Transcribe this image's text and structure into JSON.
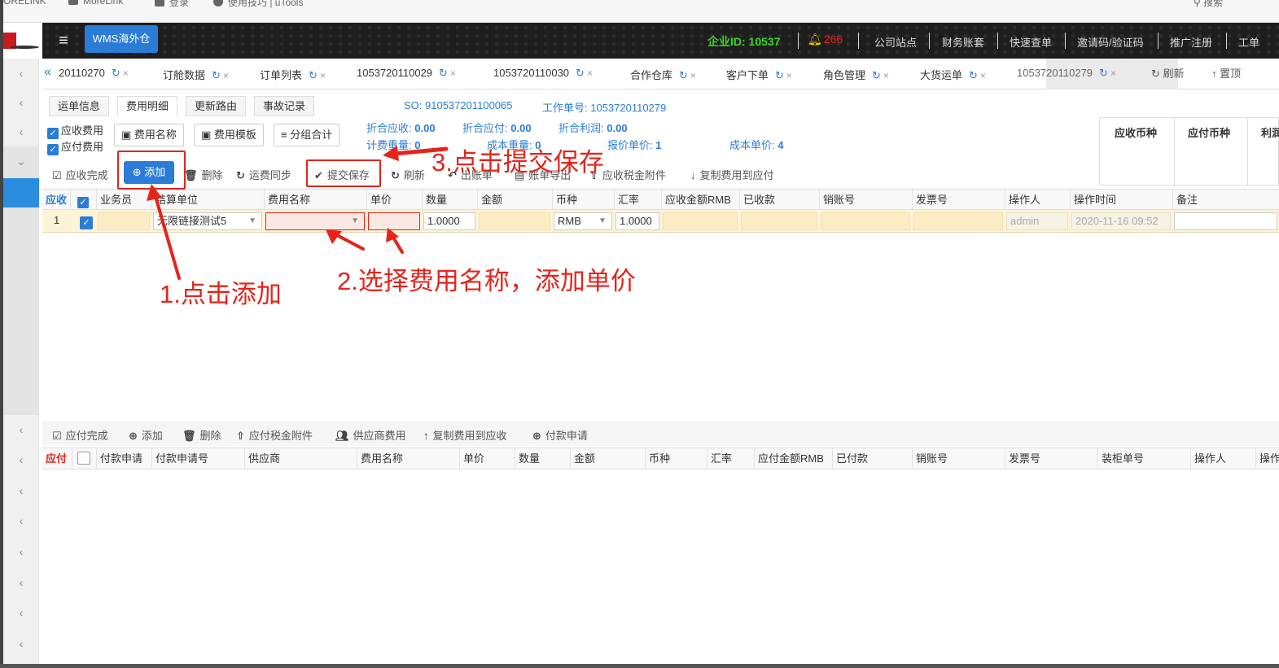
{
  "browser": {
    "bookmarks": [
      "ORELINK",
      "MoreLink",
      "登录",
      "使用技巧 | uTools",
      "搜索"
    ]
  },
  "header": {
    "wms_badge": "WMS海外仓",
    "company_id": "企业ID: 10537",
    "notification_count": "266",
    "links": [
      "公司站点",
      "财务账套",
      "快速查单",
      "邀请码/验证码",
      "推广注册",
      "工单"
    ]
  },
  "tabs": [
    "20110270",
    "订舱数据",
    "订单列表",
    "1053720110029",
    "1053720110030",
    "合作仓库",
    "客户下单",
    "角色管理",
    "大货运单",
    "1053720110279"
  ],
  "tab_tools": {
    "refresh": "刷新",
    "pin_top": "置顶"
  },
  "sub_tabs": [
    "运单信息",
    "费用明细",
    "更新路由",
    "事故记录"
  ],
  "so_label": "SO: 910537201100065",
  "work_no_label": "工作单号: 1053720110279",
  "filters": {
    "receivable_fee": "应收费用",
    "payable_fee": "应付费用"
  },
  "buttons": {
    "fee_name": "费用名称",
    "fee_template": "费用模板",
    "group_total": "分组合计",
    "receivable_done": "应收完成",
    "add": "添加",
    "delete": "删除",
    "freight_sync": "运费同步",
    "submit_save": "提交保存",
    "refresh": "刷新",
    "out_bill": "出账单",
    "bill_export": "账单导出",
    "receivable_tax_attach": "应收税金附件",
    "copy_to_payable": "复制费用到应付"
  },
  "summary": {
    "conv_receivable_label": "折合应收:",
    "conv_receivable": "0.00",
    "conv_payable_label": "折合应付:",
    "conv_payable": "0.00",
    "conv_profit_label": "折合利润:",
    "conv_profit": "0.00",
    "charge_weight_label": "计费重量:",
    "charge_weight": "0",
    "cost_weight_label": "成本重量:",
    "cost_weight": "0",
    "quote_unit_label": "报价单价:",
    "quote_unit": "1",
    "cost_unit_label": "成本单价:",
    "cost_unit": "4"
  },
  "right_panel": {
    "receivable_currency": "应收币种",
    "payable_currency": "应付币种",
    "profit": "利润"
  },
  "receivable_grid": {
    "label": "应收",
    "columns": [
      "业务员",
      "结算单位",
      "费用名称",
      "单价",
      "数量",
      "金额",
      "币种",
      "汇率",
      "应收金额RMB",
      "已收款",
      "销账号",
      "发票号",
      "操作人",
      "操作时间",
      "备注"
    ],
    "rows": [
      {
        "index": "1",
        "checked": true,
        "salesperson": "",
        "settlement_unit": "无限链接测试5",
        "fee_name": "",
        "unit_price": "",
        "quantity": "1.0000",
        "amount": "",
        "currency": "RMB",
        "rate": "1.0000",
        "rmb_amount": "",
        "received": "",
        "writeoff_no": "",
        "invoice_no": "",
        "operator": "admin",
        "op_time": "2020-11-16 09:52",
        "remark": ""
      }
    ]
  },
  "payable_toolbar": {
    "payable_done": "应付完成",
    "add": "添加",
    "delete": "删除",
    "payable_tax_attach": "应付税金附件",
    "supplier_fee": "供应商费用",
    "copy_to_receivable": "复制费用到应收",
    "payment_request": "付款申请"
  },
  "payable_grid": {
    "label": "应付",
    "columns": [
      "付款申请",
      "付款申请号",
      "供应商",
      "费用名称",
      "单价",
      "数量",
      "金额",
      "币种",
      "汇率",
      "应付金额RMB",
      "已付款",
      "销账号",
      "发票号",
      "装柜单号",
      "操作人",
      "操作"
    ]
  },
  "annotations": {
    "step1": "1.点击添加",
    "step2": "2.选择费用名称，添加单价",
    "step3": "3.点击提交保存"
  },
  "colors": {
    "accent": "#2b7cd6",
    "annotation": "#e5231b",
    "row_highlight": "#fdf3d6",
    "company_id": "#3cd624"
  }
}
